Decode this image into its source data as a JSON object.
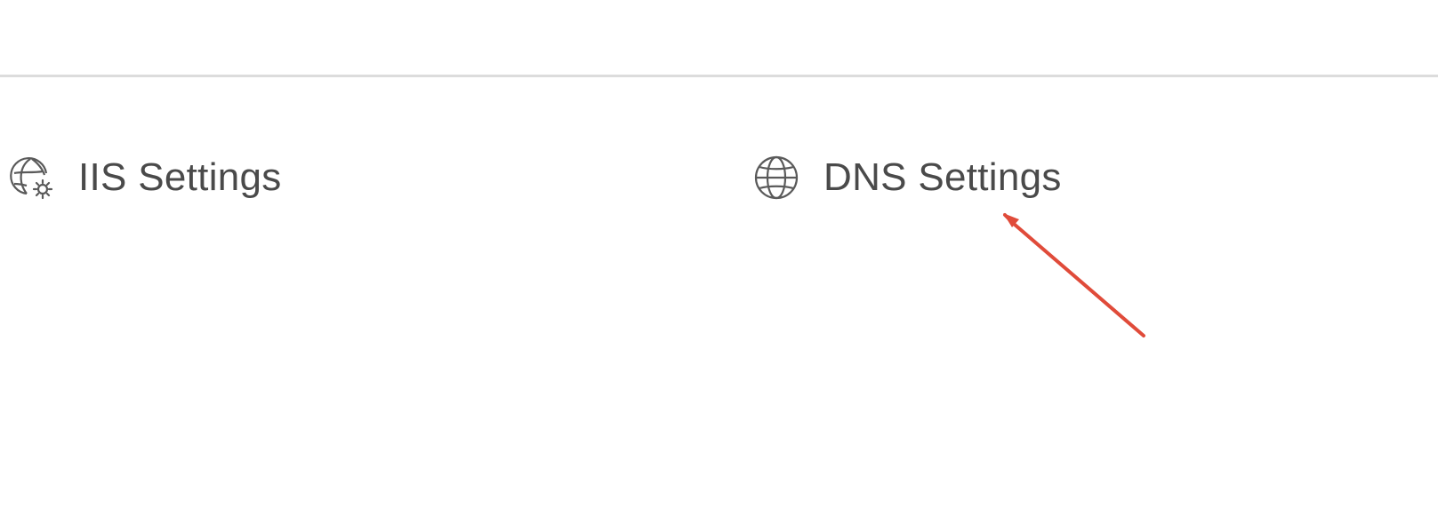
{
  "settings": {
    "items": [
      {
        "label": "IIS Settings",
        "icon": "globe-gear-icon"
      },
      {
        "label": "DNS Settings",
        "icon": "globe-icon"
      }
    ]
  },
  "annotation": {
    "arrow_color": "#e04b3a"
  },
  "colors": {
    "text": "#4a4a4a",
    "divider": "#dcdcdc"
  }
}
